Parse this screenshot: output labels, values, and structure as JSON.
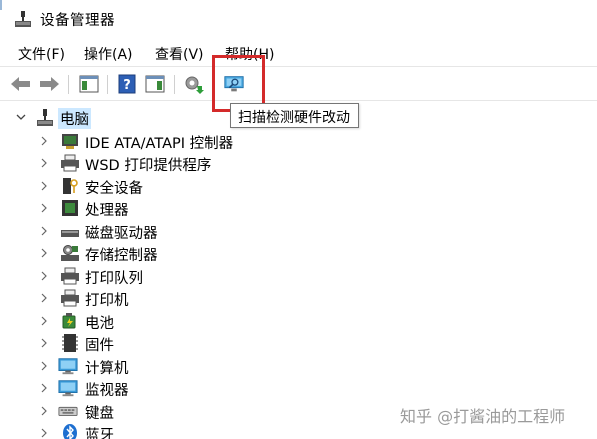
{
  "window": {
    "title": "设备管理器",
    "icon": "device-manager-icon"
  },
  "menubar": {
    "items": [
      {
        "label": "文件(F)"
      },
      {
        "label": "操作(A)"
      },
      {
        "label": "查看(V)"
      },
      {
        "label": "帮助(H)"
      }
    ]
  },
  "toolbar": {
    "buttons": [
      {
        "icon": "back-arrow-icon"
      },
      {
        "icon": "forward-arrow-icon"
      },
      {
        "icon": "show-hide-console-tree-icon"
      },
      {
        "icon": "help-icon"
      },
      {
        "icon": "properties-pane-icon"
      },
      {
        "icon": "update-driver-icon"
      },
      {
        "icon": "scan-hardware-changes-icon"
      }
    ],
    "tooltip": "扫描检测硬件改动"
  },
  "tree": {
    "root": {
      "label": "电脑",
      "icon": "computer-root-icon"
    },
    "items": [
      {
        "label": "IDE ATA/ATAPI 控制器",
        "icon": "ide-controller-icon"
      },
      {
        "label": "WSD 打印提供程序",
        "icon": "printer-icon"
      },
      {
        "label": "安全设备",
        "icon": "security-device-icon"
      },
      {
        "label": "处理器",
        "icon": "processor-icon"
      },
      {
        "label": "磁盘驱动器",
        "icon": "disk-drive-icon"
      },
      {
        "label": "存储控制器",
        "icon": "storage-controller-icon"
      },
      {
        "label": "打印队列",
        "icon": "print-queue-icon"
      },
      {
        "label": "打印机",
        "icon": "printer-icon"
      },
      {
        "label": "电池",
        "icon": "battery-icon"
      },
      {
        "label": "固件",
        "icon": "firmware-icon"
      },
      {
        "label": "计算机",
        "icon": "computer-icon"
      },
      {
        "label": "监视器",
        "icon": "monitor-icon"
      },
      {
        "label": "键盘",
        "icon": "keyboard-icon"
      },
      {
        "label": "蓝牙",
        "icon": "bluetooth-icon"
      }
    ]
  },
  "watermark": "知乎 @打酱油的工程师",
  "colors": {
    "highlight": "#d42a2a",
    "selection": "#cce8ff"
  }
}
